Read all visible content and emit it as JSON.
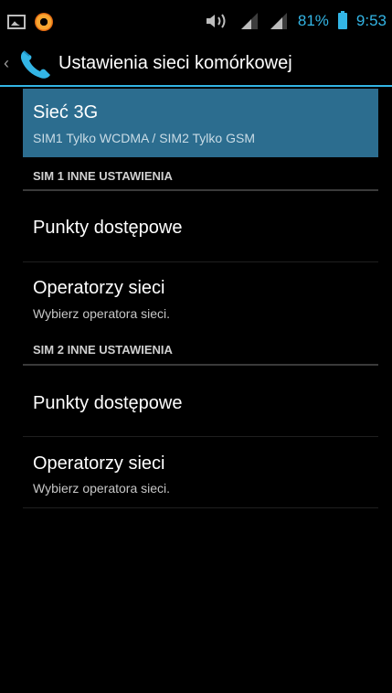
{
  "status_bar": {
    "battery_percent": "81%",
    "time": "9:53",
    "accent_color": "#33b5e5",
    "icons": [
      "picture-icon",
      "app-notification-icon",
      "volume-icon",
      "signal-sim1-icon",
      "signal-sim2-icon",
      "battery-icon"
    ]
  },
  "action_bar": {
    "title": "Ustawienia sieci komórkowej",
    "icon": "phone-icon",
    "up_glyph": "‹"
  },
  "items": {
    "network_3g": {
      "title": "Sieć 3G",
      "subtitle": "SIM1 Tylko WCDMA / SIM2 Tylko GSM",
      "selected_color": "#2c6d8f"
    },
    "sim1_header": "SIM 1 INNE USTAWIENIA",
    "sim1_apn": {
      "title": "Punkty dostępowe"
    },
    "sim1_operators": {
      "title": "Operatorzy sieci",
      "subtitle": "Wybierz operatora sieci."
    },
    "sim2_header": "SIM 2 INNE USTAWIENIA",
    "sim2_apn": {
      "title": "Punkty dostępowe"
    },
    "sim2_operators": {
      "title": "Operatorzy sieci",
      "subtitle": "Wybierz operatora sieci."
    }
  }
}
